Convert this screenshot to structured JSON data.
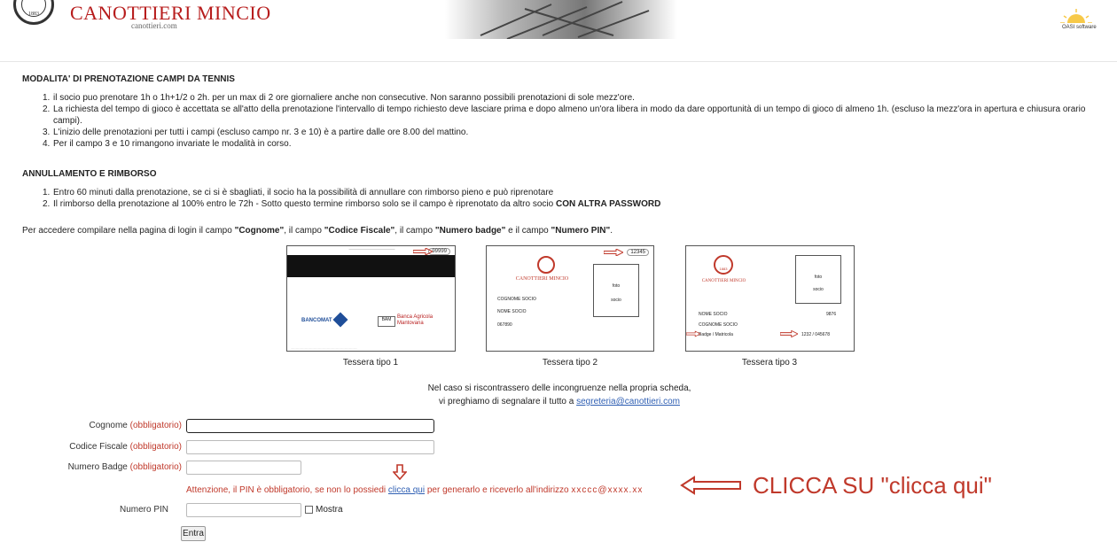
{
  "header": {
    "club_name": "CANOTTIERI MINCIO",
    "club_site": "canottieri.com",
    "seal_year": "1883",
    "partner_logo_text": "OASI software"
  },
  "booking": {
    "title": "MODALITA' DI PRENOTAZIONE CAMPI DA TENNIS",
    "rules": [
      "il socio puo prenotare 1h o 1h+1/2 o 2h. per un max di 2 ore giornaliere anche non consecutive. Non saranno possibili prenotazioni di sole mezz'ore.",
      "La richiesta del tempo di gioco è accettata se all'atto della prenotazione l'intervallo di tempo richiesto deve lasciare prima e dopo almeno un'ora libera in modo da dare opportunità di un tempo di gioco di almeno 1h. (escluso la mezz'ora in apertura e chiusura orario campi).",
      "L'inizio delle prenotazioni per tutti i campi (escluso campo nr. 3 e 10) è a partire dalle ore 8.00 del mattino.",
      "Per il campo 3 e 10 rimangono invariate le modalità in corso."
    ]
  },
  "refund": {
    "title": "ANNULLAMENTO E RIMBORSO",
    "rule1": "Entro 60 minuti dalla prenotazione, se ci si è sbagliati, il socio ha la possibilità di annullare con rimborso pieno e può riprenotare",
    "rule2_text": "Il rimborso della prenotazione al 100% entro le 72h - Sotto questo termine rimborso solo se il campo è riprenotato da altro socio ",
    "rule2_bold": "CON ALTRA PASSWORD"
  },
  "access": {
    "t1": "Per accedere compilare nella pagina di login il campo ",
    "f1": "\"Cognome\"",
    "t2": ", il campo ",
    "f2": "\"Codice Fiscale\"",
    "t3": ", il campo ",
    "f3": "\"Numero badge\"",
    "t4": " e il campo ",
    "f4": "\"Numero PIN\"",
    "t5": "."
  },
  "cards": [
    {
      "caption": "Tessera tipo 1",
      "number": "99999",
      "bancomat": "BANCOMAT",
      "bank": "Banca Agricola Mantovana"
    },
    {
      "caption": "Tessera tipo 2",
      "number": "12345",
      "club": "CANOTTIERI MINCIO",
      "foto": "foto",
      "socio": "socio",
      "cognome": "COGNOME SOCIO",
      "nome": "NOME SOCIO",
      "code": "067890"
    },
    {
      "caption": "Tessera tipo 3",
      "club": "CANOTTIERI MINCIO",
      "foto": "foto",
      "socio": "socio",
      "nome": "NOME SOCIO",
      "cognome": "COGNOME SOCIO",
      "n1": "9876",
      "badge": "Badge / Matricola",
      "n2": "1232 / 045678",
      "year": "1883"
    }
  ],
  "notice": {
    "line1": "Nel caso si riscontrassero delle incongruenze nella propria scheda,",
    "line2_text": "vi preghiamo di segnalare il tutto a ",
    "email": "segreteria@canottieri.com"
  },
  "form": {
    "required": "(obbligatorio)",
    "cognome_label": "Cognome",
    "cf_label": "Codice Fiscale",
    "badge_label": "Numero Badge",
    "pin_warning_a": "Attenzione, il PIN è obbligatorio, se non lo possiedi ",
    "pin_link": "clicca qui",
    "pin_warning_b": " per generarlo e riceverlo all'indirizzo ",
    "pin_email": "xxccc@xxxx.xx",
    "pin_label": "Numero PIN",
    "show_label": "Mostra",
    "submit": "Entra"
  },
  "annotation": {
    "text": "CLICCA SU \"clicca qui\"",
    "color": "#c0392b"
  }
}
